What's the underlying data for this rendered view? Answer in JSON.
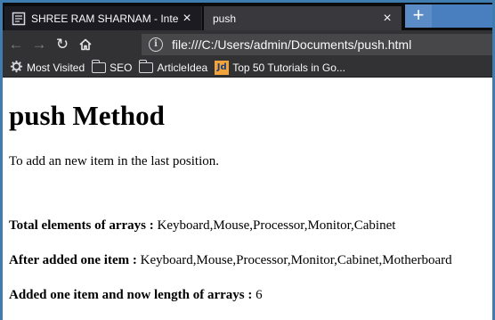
{
  "tabs": [
    {
      "title": "SHREE RAM SHARNAM - Interr",
      "close": "×"
    },
    {
      "title": "push",
      "close": "×"
    }
  ],
  "new_tab": "+",
  "nav": {
    "back": "←",
    "forward": "→",
    "reload": "↻",
    "home": "⌂",
    "info": "i",
    "url": "file:///C:/Users/admin/Documents/push.html"
  },
  "bookmarks": [
    {
      "label": "Most Visited",
      "icon": "gear-icon"
    },
    {
      "label": "SEO",
      "icon": "folder-icon"
    },
    {
      "label": "ArticleIdea",
      "icon": "folder-icon"
    },
    {
      "label": "Top 50 Tutorials in Go...",
      "icon": "jd-logo-icon",
      "logo_text": "Jd"
    }
  ],
  "page": {
    "heading": "push Method",
    "description": "To add an new item in the last position.",
    "total_label": "Total elements of arrays :",
    "total_value": " Keyboard,Mouse,Processor,Monitor,Cabinet",
    "after_label": "After added one item :",
    "after_value": " Keyboard,Mouse,Processor,Monitor,Cabinet,Motherboard",
    "length_label": "Added one item and now length of arrays :",
    "length_value": " 6"
  },
  "colors": {
    "tab_strip": "#0c0c0d",
    "active_tab": "#38383d",
    "toolbar": "#323234",
    "urlbar": "#474749",
    "new_tab_button": "#5b8cc7",
    "window_border": "#3f7db0"
  }
}
